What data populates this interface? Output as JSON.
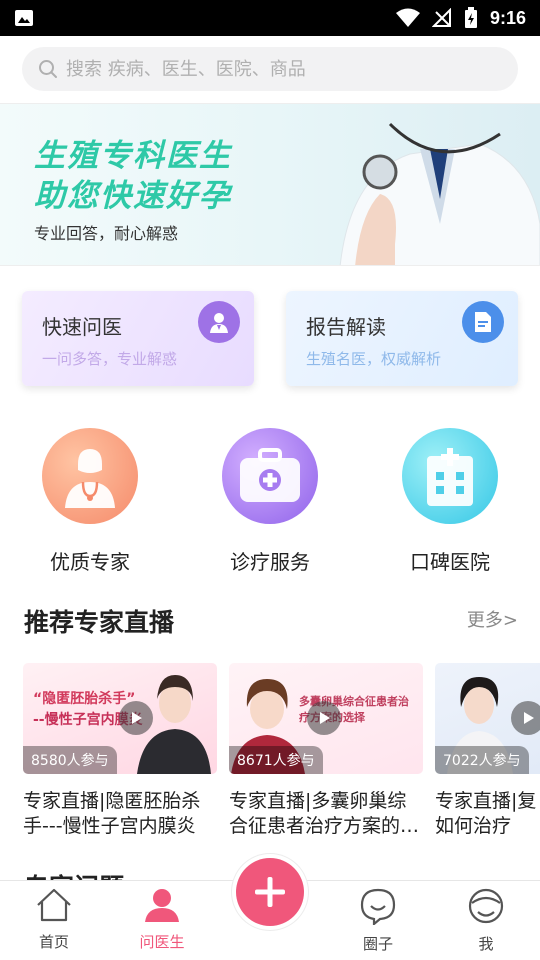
{
  "status_bar": {
    "time": "9:16"
  },
  "search": {
    "placeholder": "搜索 疾病、医生、医院、商品"
  },
  "banner": {
    "title_line1": "生殖专科医生",
    "title_line2": "助您快速好孕",
    "subtitle": "专业回答，耐心解惑"
  },
  "quick_cards": [
    {
      "title": "快速问医",
      "subtitle": "一问多答，专业解惑",
      "icon": "doctor-icon"
    },
    {
      "title": "报告解读",
      "subtitle": "生殖名医，权威解析",
      "icon": "document-icon"
    }
  ],
  "categories": [
    {
      "label": "优质专家",
      "icon": "doctor-avatar-icon"
    },
    {
      "label": "诊疗服务",
      "icon": "medical-kit-icon"
    },
    {
      "label": "口碑医院",
      "icon": "hospital-icon"
    }
  ],
  "live_section": {
    "title": "推荐专家直播",
    "more": "更多>",
    "items": [
      {
        "count": "8580人参与",
        "title": "专家直播|隐匿胚胎杀手---慢性子宫内膜炎",
        "thumb_a": "“隐匿胚胎杀手”",
        "thumb_b": "--慢性子宫内膜炎"
      },
      {
        "count": "8671人参与",
        "title": "专家直播|多囊卵巢综合征患者治疗方案的…",
        "thumb_c": "多囊卵巢综合征患者治疗方案的选择"
      },
      {
        "count": "7022人参与",
        "title": "专家直播|复如何治疗"
      }
    ]
  },
  "partial_heading": "专家问题",
  "bottom_nav": [
    {
      "label": "首页",
      "icon": "home-icon"
    },
    {
      "label": "问医生",
      "icon": "person-icon"
    },
    {
      "label": "",
      "icon": "plus-icon"
    },
    {
      "label": "圈子",
      "icon": "chat-icon"
    },
    {
      "label": "我",
      "icon": "profile-icon"
    }
  ],
  "colors": {
    "accent": "#f0577b",
    "banner_green": "#2ec9a7"
  }
}
